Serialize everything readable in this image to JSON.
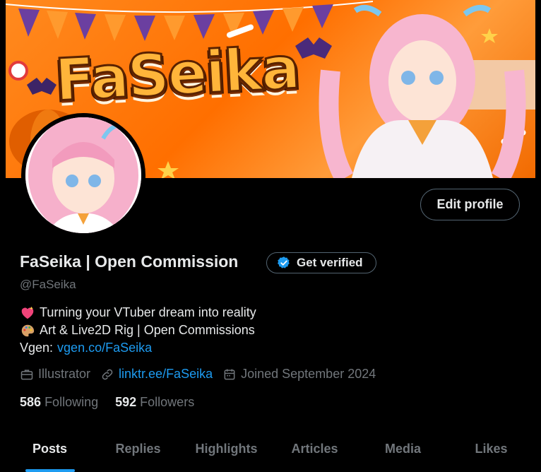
{
  "banner": {
    "logo_text": "FaSeika"
  },
  "profile": {
    "name": "FaSeika | Open Commission",
    "handle": "@FaSeika",
    "edit_label": "Edit profile",
    "verify_label": "Get verified",
    "bio": [
      {
        "emoji": "sparkle-heart-icon",
        "text": "Turning your VTuber dream into reality"
      },
      {
        "emoji": "palette-icon",
        "text": "Art & Live2D Rig | Open Commissions"
      }
    ],
    "vgen_prefix": "Vgen:",
    "vgen_link": "vgen.co/FaSeika",
    "occupation": "Illustrator",
    "link": "linktr.ee/FaSeika",
    "joined": "Joined September 2024",
    "following_count": "586",
    "following_label": "Following",
    "followers_count": "592",
    "followers_label": "Followers"
  },
  "tabs": [
    {
      "label": "Posts",
      "active": true
    },
    {
      "label": "Replies"
    },
    {
      "label": "Highlights"
    },
    {
      "label": "Articles"
    },
    {
      "label": "Media"
    },
    {
      "label": "Likes"
    }
  ],
  "colors": {
    "accent": "#1d9bf0",
    "muted": "#71767b",
    "text": "#e7e9ea",
    "banner_orange": "#ff7a12"
  }
}
